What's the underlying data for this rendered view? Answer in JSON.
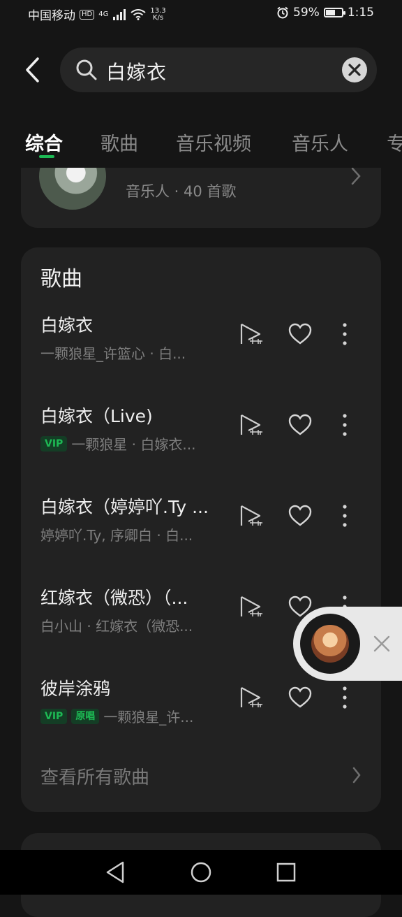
{
  "status_bar": {
    "carrier": "中国移动",
    "hd": "HD",
    "signal": "4G",
    "net_speed_value": "13.3",
    "net_speed_unit": "K/s",
    "battery_percent": "59%",
    "battery_level": 0.59,
    "time": "1:15"
  },
  "search": {
    "query": "白嫁衣"
  },
  "tabs": [
    {
      "label": "综合",
      "active": true
    },
    {
      "label": "歌曲",
      "active": false
    },
    {
      "label": "音乐视频",
      "active": false
    },
    {
      "label": "音乐人",
      "active": false
    },
    {
      "label": "专",
      "active": false
    }
  ],
  "artist_card": {
    "subtitle": "音乐人 · 40 首歌"
  },
  "songs_section": {
    "title": "歌曲",
    "items": [
      {
        "title": "白嫁衣",
        "badges": [],
        "meta": "一颗狼星_许篮心 · 白..."
      },
      {
        "title": "白嫁衣（Live)",
        "badges": [
          "VIP"
        ],
        "meta": "一颗狼星 · 白嫁衣..."
      },
      {
        "title": "白嫁衣（婷婷吖.Ty ...",
        "badges": [],
        "meta": "婷婷吖.Ty, 序卿白 · 白..."
      },
      {
        "title": "红嫁衣（微恐）（...",
        "badges": [],
        "meta": "白小山 · 红嫁衣（微恐..."
      },
      {
        "title": "彼岸涂鸦",
        "badges": [
          "VIP",
          "原唱"
        ],
        "meta": "一颗狼星_许..."
      }
    ],
    "see_all": "查看所有歌曲"
  },
  "colors": {
    "accent": "#1db954",
    "background": "#151515",
    "card": "#222222"
  }
}
